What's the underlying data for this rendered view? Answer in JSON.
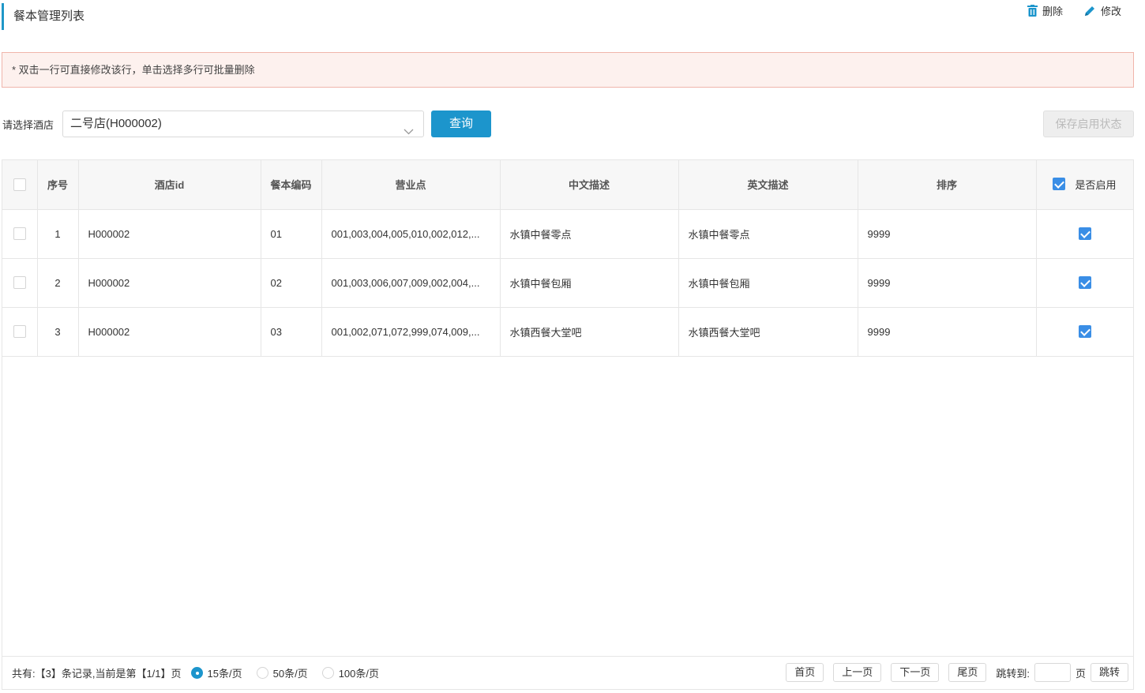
{
  "page": {
    "title": "餐本管理列表",
    "actions": [
      {
        "label": "删除",
        "icon": "trash-icon"
      },
      {
        "label": "修改",
        "icon": "pencil-icon"
      }
    ],
    "notice": "* 双击一行可直接修改该行，单击选择多行可批量删除"
  },
  "filter": {
    "label": "请选择酒店",
    "hotel_value": "二号店(H000002)",
    "query_label": "查询",
    "save_label": "保存启用状态"
  },
  "table": {
    "headers": [
      "序号",
      "酒店id",
      "餐本编码",
      "营业点",
      "中文描述",
      "英文描述",
      "排序",
      "是否启用"
    ],
    "header_enable_checked": true,
    "rows": [
      {
        "no": "1",
        "hotel_id": "H000002",
        "code": "01",
        "outlets": "001,003,004,005,010,002,012,...",
        "cn_desc": "水镇中餐零点",
        "en_desc": "水镇中餐零点",
        "sort": "9999",
        "enabled": true
      },
      {
        "no": "2",
        "hotel_id": "H000002",
        "code": "02",
        "outlets": "001,003,006,007,009,002,004,...",
        "cn_desc": "水镇中餐包厢",
        "en_desc": "水镇中餐包厢",
        "sort": "9999",
        "enabled": true
      },
      {
        "no": "3",
        "hotel_id": "H000002",
        "code": "03",
        "outlets": "001,002,071,072,999,074,009,...",
        "cn_desc": "水镇西餐大堂吧",
        "en_desc": "水镇西餐大堂吧",
        "sort": "9999",
        "enabled": true
      }
    ]
  },
  "pager": {
    "info": "共有:【3】条记录,当前是第【1/1】页",
    "page_sizes": [
      "15条/页",
      "50条/页",
      "100条/页"
    ],
    "selected_size": "15条/页",
    "first": "首页",
    "prev": "上一页",
    "next": "下一页",
    "last": "尾页",
    "jump_label": "跳转到:",
    "page_unit": "页",
    "jump_button": "跳转"
  },
  "colors": {
    "accent": "#1c95cc",
    "checkbox": "#3a8ee6",
    "notice_bg": "#fdf1ee",
    "notice_border": "#f0b5ab"
  }
}
